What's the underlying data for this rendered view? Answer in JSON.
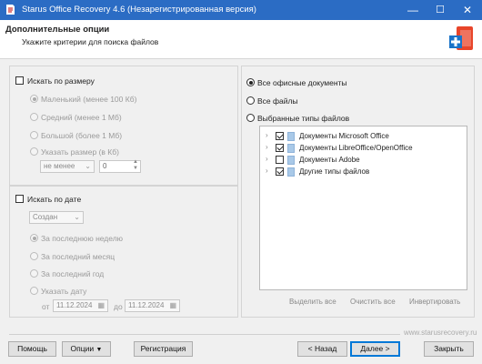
{
  "window": {
    "title": "Starus Office Recovery 4.6 (Незарегистрированная версия)",
    "controls": {
      "minimize": "—",
      "maximize": "☐",
      "close": "✕"
    }
  },
  "header": {
    "title": "Дополнительные опции",
    "subtitle": "Укажите критерии для поиска файлов"
  },
  "size_filter": {
    "checkbox_label": "Искать по размеру",
    "checked": false,
    "options": [
      {
        "label": "Маленький (менее 100 Кб)",
        "selected": true
      },
      {
        "label": "Средний (менее 1 Мб)",
        "selected": false
      },
      {
        "label": "Большой (более 1 Мб)",
        "selected": false
      },
      {
        "label": "Указать размер (в Кб)",
        "selected": false
      }
    ],
    "comparison": "не менее",
    "size_value": "0"
  },
  "date_filter": {
    "checkbox_label": "Искать по дате",
    "checked": false,
    "date_type": "Создан",
    "options": [
      {
        "label": "За последнюю неделю",
        "selected": true
      },
      {
        "label": "За последний месяц",
        "selected": false
      },
      {
        "label": "За последний год",
        "selected": false
      },
      {
        "label": "Указать дату",
        "selected": false
      }
    ],
    "from_label": "от",
    "from_date": "11.12.2024",
    "to_label": "до",
    "to_date": "11.12.2024"
  },
  "file_types": {
    "options": [
      {
        "label": "Все офисные документы",
        "selected": true
      },
      {
        "label": "Все файлы",
        "selected": false
      },
      {
        "label": "Выбранные типы файлов",
        "selected": false
      }
    ],
    "tree": [
      {
        "label": "Документы Microsoft Office",
        "checked": true
      },
      {
        "label": "Документы LibreOffice/OpenOffice",
        "checked": true
      },
      {
        "label": "Документы Adobe",
        "checked": false
      },
      {
        "label": "Другие типы файлов",
        "checked": true
      }
    ],
    "select_all": "Выделить все",
    "clear_all": "Очистить все",
    "invert": "Инвертировать"
  },
  "footer": {
    "website": "www.starusrecovery.ru",
    "help": "Помощь",
    "options": "Опции",
    "register": "Регистрация",
    "back": "< Назад",
    "next": "Далее >",
    "close": "Закрыть"
  },
  "colors": {
    "titlebar": "#2b6cc4",
    "accent": "#0078d7"
  }
}
